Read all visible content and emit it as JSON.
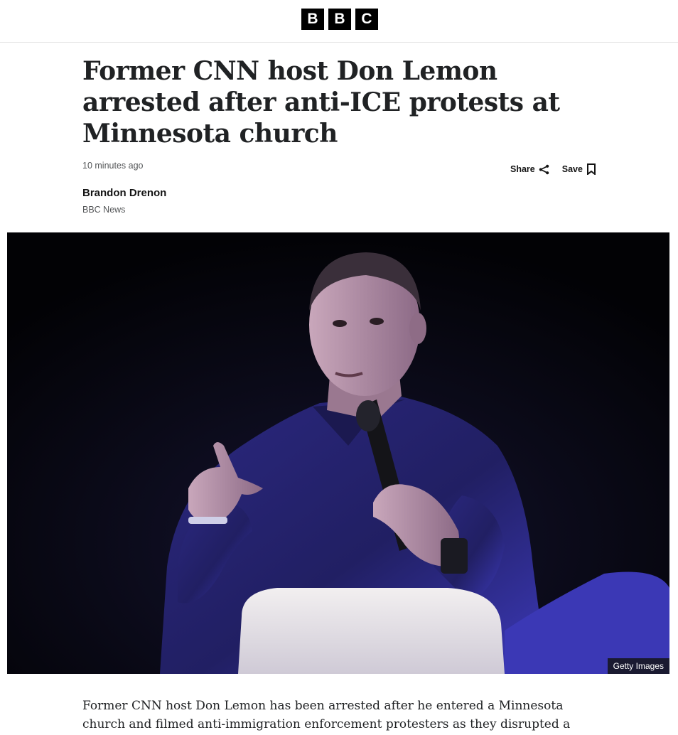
{
  "brand": {
    "letters": [
      "B",
      "B",
      "C"
    ]
  },
  "article": {
    "headline": "Former CNN host Don Lemon arrested after anti-ICE protests at Minnesota church",
    "timestamp": "10 minutes ago",
    "author": "Brandon Drenon",
    "organization": "BBC News",
    "image_credit": "Getty Images",
    "lead_paragraph": "Former CNN host Don Lemon has been arrested after he entered a Minnesota church and filmed anti-immigration enforcement protesters as they disrupted a service."
  },
  "actions": {
    "share_label": "Share",
    "save_label": "Save",
    "share_icon": "share-icon",
    "save_icon": "bookmark-icon"
  },
  "colors": {
    "brand_black": "#000000",
    "headline": "#202224",
    "meta_grey": "#545658",
    "stage_light": "#3a37c8"
  }
}
